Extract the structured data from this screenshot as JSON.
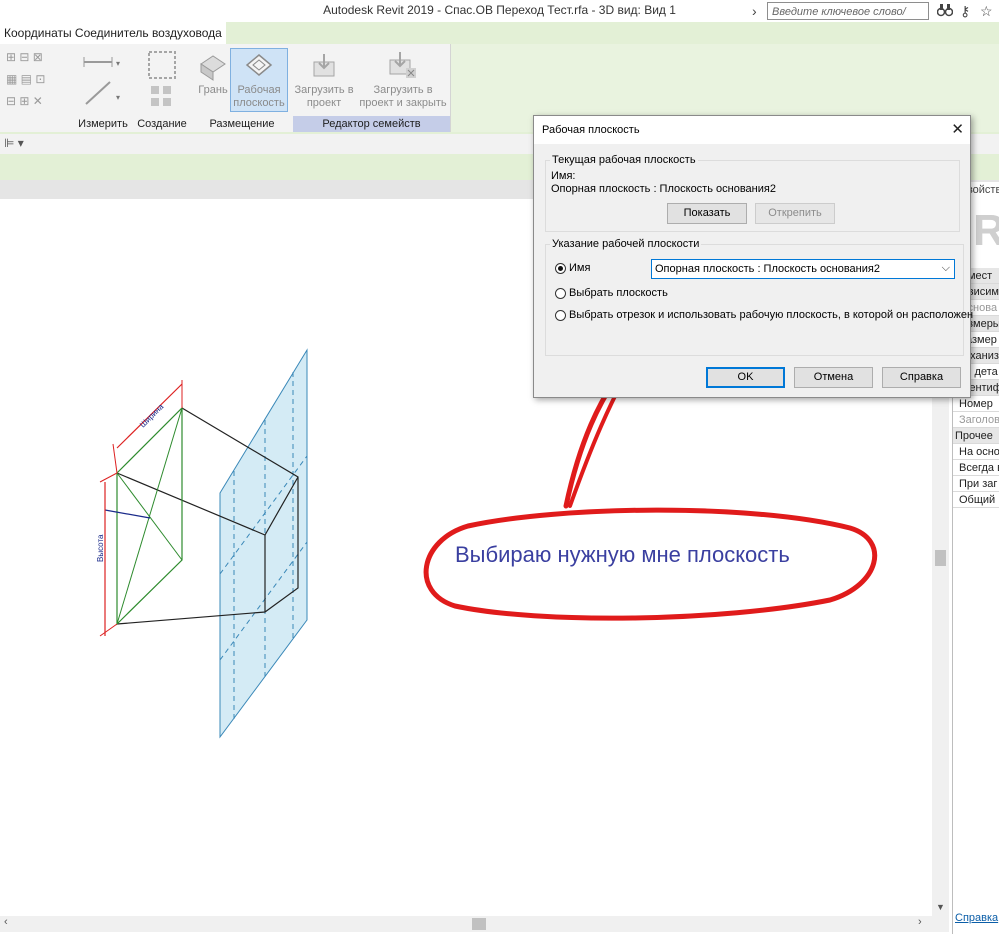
{
  "window": {
    "title": "Autodesk Revit 2019 - Спас.ОВ Переход Тест.rfa - 3D вид: Вид 1",
    "search_placeholder": "Введите ключевое слово/фразу"
  },
  "ribbon": {
    "active_tab": "Координаты Соединитель воздуховода",
    "tools": {
      "face": "Грань",
      "workplane": "Рабочая плоскость",
      "load_project": "Загрузить в проект",
      "load_close": "Загрузить в проект и закрыть"
    },
    "panels": {
      "measure": "Измерить",
      "create": "Создание",
      "placement": "Размещение",
      "family_editor": "Редактор семейств"
    }
  },
  "dialog": {
    "title": "Рабочая плоскость",
    "current_group": "Текущая рабочая плоскость",
    "name_label": "Имя:",
    "current_name": "Опорная плоскость : Плоскость основания2",
    "show_button": "Показать",
    "detach_button": "Открепить",
    "specify_group": "Указание рабочей плоскости",
    "radio_name": "Имя",
    "radio_pick_plane": "Выбрать плоскость",
    "radio_pick_line": "Выбрать отрезок и использовать рабочую плоскость, в которой он расположен",
    "selected_value": "Опорная плоскость : Плоскость основания2",
    "ok": "OK",
    "cancel": "Отмена",
    "help": "Справка"
  },
  "annotation": {
    "text": "Выбираю нужную мне плоскость",
    "color": "#e01b1b"
  },
  "model": {
    "dim_width": "Ширина",
    "dim_height": "Высота"
  },
  "properties": {
    "header": "Свойства",
    "rows": [
      "Ремест",
      "Зависим",
      "Основа",
      "Размеры",
      "Размер",
      "Механиз",
      "Уп дета",
      "Идентиф",
      "Номер",
      "Заголов",
      "Прочее",
      "На осно",
      "Всегда в",
      "При заг",
      "Общий"
    ],
    "help_link": "Справка"
  }
}
